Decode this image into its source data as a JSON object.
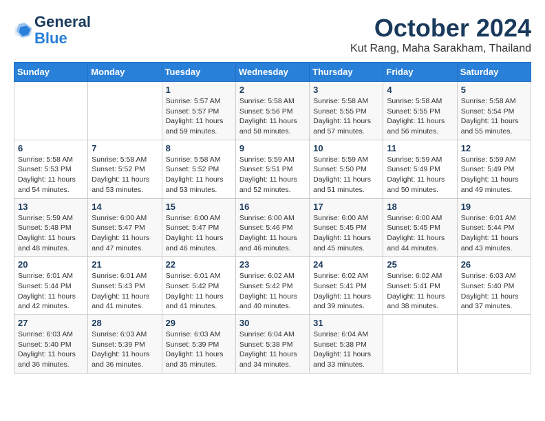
{
  "header": {
    "logo_line1": "General",
    "logo_line2": "Blue",
    "month": "October 2024",
    "location": "Kut Rang, Maha Sarakham, Thailand"
  },
  "weekdays": [
    "Sunday",
    "Monday",
    "Tuesday",
    "Wednesday",
    "Thursday",
    "Friday",
    "Saturday"
  ],
  "weeks": [
    [
      {
        "day": "",
        "info": ""
      },
      {
        "day": "",
        "info": ""
      },
      {
        "day": "1",
        "sunrise": "5:57 AM",
        "sunset": "5:57 PM",
        "daylight": "11 hours and 59 minutes."
      },
      {
        "day": "2",
        "sunrise": "5:58 AM",
        "sunset": "5:56 PM",
        "daylight": "11 hours and 58 minutes."
      },
      {
        "day": "3",
        "sunrise": "5:58 AM",
        "sunset": "5:55 PM",
        "daylight": "11 hours and 57 minutes."
      },
      {
        "day": "4",
        "sunrise": "5:58 AM",
        "sunset": "5:55 PM",
        "daylight": "11 hours and 56 minutes."
      },
      {
        "day": "5",
        "sunrise": "5:58 AM",
        "sunset": "5:54 PM",
        "daylight": "11 hours and 55 minutes."
      }
    ],
    [
      {
        "day": "6",
        "sunrise": "5:58 AM",
        "sunset": "5:53 PM",
        "daylight": "11 hours and 54 minutes."
      },
      {
        "day": "7",
        "sunrise": "5:58 AM",
        "sunset": "5:52 PM",
        "daylight": "11 hours and 53 minutes."
      },
      {
        "day": "8",
        "sunrise": "5:58 AM",
        "sunset": "5:52 PM",
        "daylight": "11 hours and 53 minutes."
      },
      {
        "day": "9",
        "sunrise": "5:59 AM",
        "sunset": "5:51 PM",
        "daylight": "11 hours and 52 minutes."
      },
      {
        "day": "10",
        "sunrise": "5:59 AM",
        "sunset": "5:50 PM",
        "daylight": "11 hours and 51 minutes."
      },
      {
        "day": "11",
        "sunrise": "5:59 AM",
        "sunset": "5:49 PM",
        "daylight": "11 hours and 50 minutes."
      },
      {
        "day": "12",
        "sunrise": "5:59 AM",
        "sunset": "5:49 PM",
        "daylight": "11 hours and 49 minutes."
      }
    ],
    [
      {
        "day": "13",
        "sunrise": "5:59 AM",
        "sunset": "5:48 PM",
        "daylight": "11 hours and 48 minutes."
      },
      {
        "day": "14",
        "sunrise": "6:00 AM",
        "sunset": "5:47 PM",
        "daylight": "11 hours and 47 minutes."
      },
      {
        "day": "15",
        "sunrise": "6:00 AM",
        "sunset": "5:47 PM",
        "daylight": "11 hours and 46 minutes."
      },
      {
        "day": "16",
        "sunrise": "6:00 AM",
        "sunset": "5:46 PM",
        "daylight": "11 hours and 46 minutes."
      },
      {
        "day": "17",
        "sunrise": "6:00 AM",
        "sunset": "5:45 PM",
        "daylight": "11 hours and 45 minutes."
      },
      {
        "day": "18",
        "sunrise": "6:00 AM",
        "sunset": "5:45 PM",
        "daylight": "11 hours and 44 minutes."
      },
      {
        "day": "19",
        "sunrise": "6:01 AM",
        "sunset": "5:44 PM",
        "daylight": "11 hours and 43 minutes."
      }
    ],
    [
      {
        "day": "20",
        "sunrise": "6:01 AM",
        "sunset": "5:44 PM",
        "daylight": "11 hours and 42 minutes."
      },
      {
        "day": "21",
        "sunrise": "6:01 AM",
        "sunset": "5:43 PM",
        "daylight": "11 hours and 41 minutes."
      },
      {
        "day": "22",
        "sunrise": "6:01 AM",
        "sunset": "5:42 PM",
        "daylight": "11 hours and 41 minutes."
      },
      {
        "day": "23",
        "sunrise": "6:02 AM",
        "sunset": "5:42 PM",
        "daylight": "11 hours and 40 minutes."
      },
      {
        "day": "24",
        "sunrise": "6:02 AM",
        "sunset": "5:41 PM",
        "daylight": "11 hours and 39 minutes."
      },
      {
        "day": "25",
        "sunrise": "6:02 AM",
        "sunset": "5:41 PM",
        "daylight": "11 hours and 38 minutes."
      },
      {
        "day": "26",
        "sunrise": "6:03 AM",
        "sunset": "5:40 PM",
        "daylight": "11 hours and 37 minutes."
      }
    ],
    [
      {
        "day": "27",
        "sunrise": "6:03 AM",
        "sunset": "5:40 PM",
        "daylight": "11 hours and 36 minutes."
      },
      {
        "day": "28",
        "sunrise": "6:03 AM",
        "sunset": "5:39 PM",
        "daylight": "11 hours and 36 minutes."
      },
      {
        "day": "29",
        "sunrise": "6:03 AM",
        "sunset": "5:39 PM",
        "daylight": "11 hours and 35 minutes."
      },
      {
        "day": "30",
        "sunrise": "6:04 AM",
        "sunset": "5:38 PM",
        "daylight": "11 hours and 34 minutes."
      },
      {
        "day": "31",
        "sunrise": "6:04 AM",
        "sunset": "5:38 PM",
        "daylight": "11 hours and 33 minutes."
      },
      {
        "day": "",
        "info": ""
      },
      {
        "day": "",
        "info": ""
      }
    ]
  ]
}
